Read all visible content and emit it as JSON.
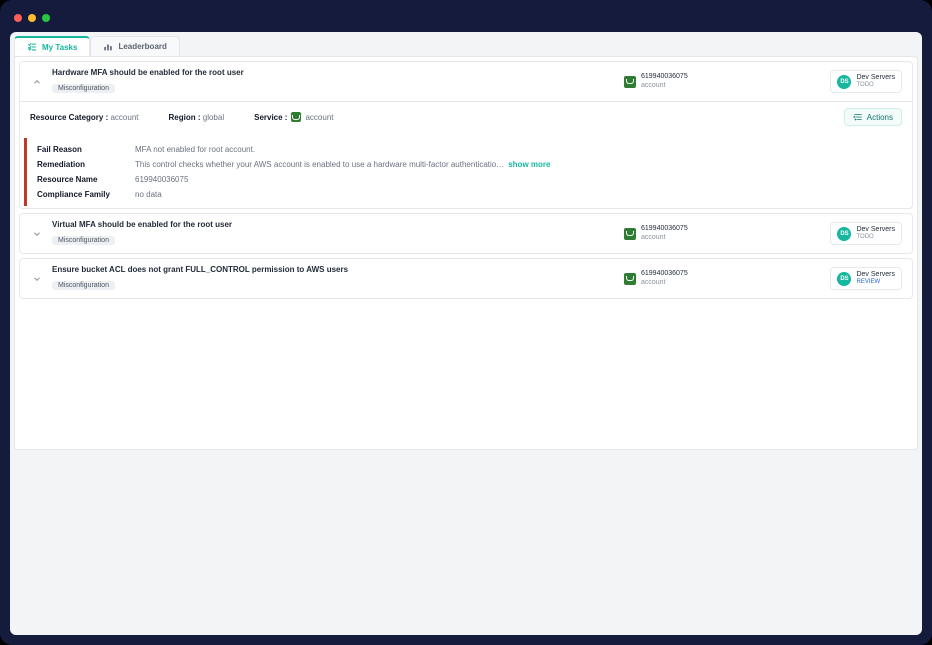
{
  "tabs": {
    "my_tasks": "My Tasks",
    "leaderboard": "Leaderboard"
  },
  "actions_button": "Actions",
  "show_more": "show more",
  "detail": {
    "resource_category_label": "Resource Category :",
    "resource_category_value": "account",
    "region_label": "Region :",
    "region_value": "global",
    "service_label": "Service :",
    "service_value": "account"
  },
  "reason": {
    "fail_label": "Fail Reason",
    "fail_value": "MFA not enabled for root account.",
    "remediation_label": "Remediation",
    "remediation_value": "This control checks whether your AWS account is enabled to use a hardware multi-factor authenticatio…",
    "resource_name_label": "Resource Name",
    "resource_name_value": "619940036075",
    "compliance_label": "Compliance Family",
    "compliance_value": "no data"
  },
  "tasks": [
    {
      "title": "Hardware MFA should be enabled for the root user",
      "tag": "Misconfiguration",
      "account_id": "619940036075",
      "account_type": "account",
      "server_badge": "DS",
      "server_name": "Dev Servers",
      "status": "TODO",
      "status_class": ""
    },
    {
      "title": "Virtual MFA should be enabled for the root user",
      "tag": "Misconfiguration",
      "account_id": "619940036075",
      "account_type": "account",
      "server_badge": "DS",
      "server_name": "Dev Servers",
      "status": "TODO",
      "status_class": ""
    },
    {
      "title": "Ensure bucket ACL does not grant FULL_CONTROL permission to AWS users",
      "tag": "Misconfiguration",
      "account_id": "619940036075",
      "account_type": "account",
      "server_badge": "DS",
      "server_name": "Dev Servers",
      "status": "REVIEW",
      "status_class": "review"
    }
  ]
}
